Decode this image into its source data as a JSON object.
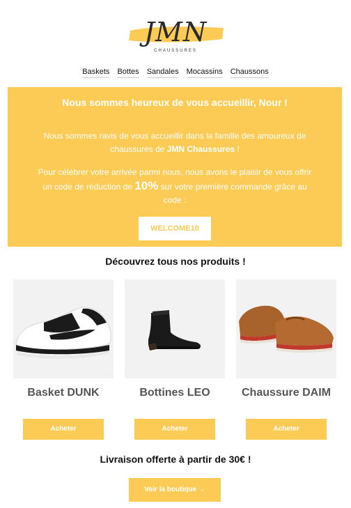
{
  "brand": {
    "logo_text": "JMN",
    "tagline": "CHAUSSURES"
  },
  "nav": {
    "items": [
      "Baskets",
      "Bottes",
      "Sandales",
      "Mocassins",
      "Chaussons"
    ]
  },
  "hero": {
    "title": "Nous sommes heureux de vous accueillir, Nour !",
    "p1_before": "Nous sommes ravis de vous accueillir dans la famille des amoureux de chaussures de ",
    "p1_brand": "JMN Chaussures",
    "p1_after": " !",
    "p2_before": "Pour célébrer votre arrivée parmi nous, nous avons le plaisir de vous offrir un code de réduction de ",
    "p2_discount": "10%",
    "p2_after": " sur votre première commande grâce au code :",
    "code": "WELCOME10"
  },
  "products_title": "Découvrez tous nos produits !",
  "products": [
    {
      "name": "Basket DUNK",
      "image_icon": "sneaker-image",
      "buy_label": "Acheter"
    },
    {
      "name": "Bottines LEO",
      "image_icon": "boot-image",
      "buy_label": "Acheter"
    },
    {
      "name": "Chaussure DAIM",
      "image_icon": "derby-shoe-image",
      "buy_label": "Acheter"
    }
  ],
  "shipping_text": "Livraison offerte à partir de 30€ !",
  "shop_button": "Voir la boutique →",
  "colors": {
    "accent": "#fccb55",
    "text_dark": "#111111",
    "product_name": "#555555"
  }
}
